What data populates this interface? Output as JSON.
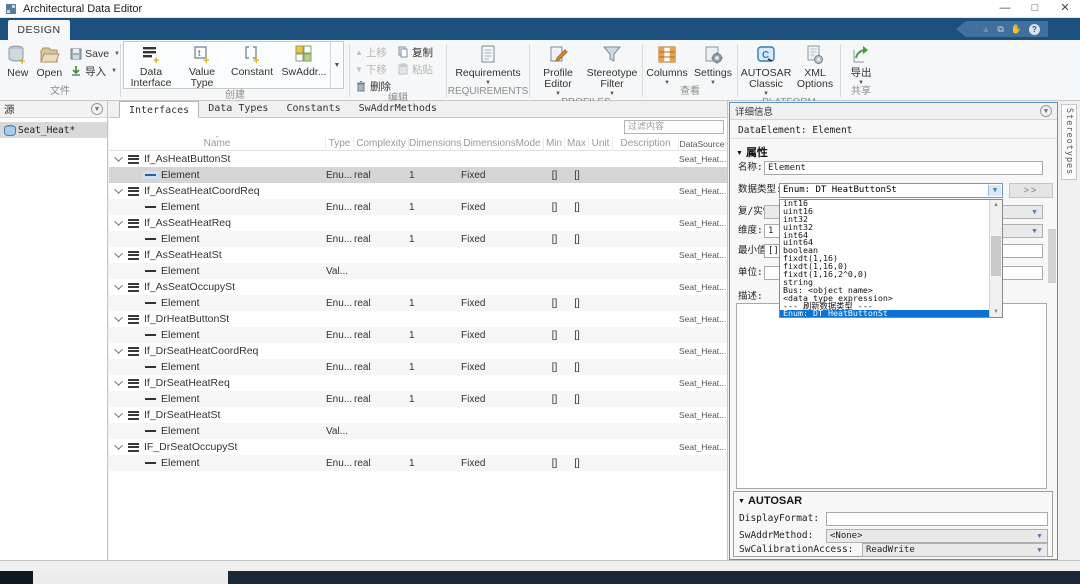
{
  "window": {
    "title": "Architectural Data Editor",
    "minimize": "—",
    "maximize": "□",
    "close": "✕"
  },
  "ribbon": {
    "tab": "DESIGN"
  },
  "toolbar": {
    "file": {
      "label": "文件",
      "new": "New",
      "open": "Open",
      "save": "Save",
      "import": "导入"
    },
    "create": {
      "label": "创建",
      "data_interface": "Data Interface",
      "value_type": "Value Type",
      "constant": "Constant",
      "swaddr": "SwAddr..."
    },
    "edit": {
      "label": "编辑",
      "move_up": "上移",
      "move_down": "下移",
      "delete": "删除",
      "copy": "复制",
      "paste": "粘贴"
    },
    "requirements": {
      "label": "REQUIREMENTS",
      "requirements": "Requirements"
    },
    "profiles": {
      "label": "PROFILES",
      "profile_editor": "Profile Editor",
      "stereotype_filter": "Stereotype Filter"
    },
    "view": {
      "label": "查看",
      "columns": "Columns",
      "settings": "Settings"
    },
    "platform": {
      "label": "PLATFORM",
      "autosar": "AUTOSAR Classic",
      "xml_options": "XML Options"
    },
    "share": {
      "label": "共享",
      "export": "导出"
    }
  },
  "source_panel": {
    "title": "源",
    "item": "Seat_Heat*"
  },
  "main": {
    "tabs": [
      {
        "label": "Interfaces",
        "active": true
      },
      {
        "label": "Data Types",
        "active": false
      },
      {
        "label": "Constants",
        "active": false
      },
      {
        "label": "SwAddrMethods",
        "active": false
      }
    ],
    "filter_placeholder": "过滤内容",
    "table": {
      "columns": [
        "Name",
        "Type",
        "Complexity",
        "Dimensions",
        "DimensionsMode",
        "Min",
        "Max",
        "Unit",
        "Description",
        "DataSource"
      ],
      "rows": [
        {
          "name": "If_AsHeatButtonSt",
          "kind": "interface",
          "dataSource": "Seat_Heat...."
        },
        {
          "name": "Element",
          "kind": "element",
          "selected": true,
          "type": "Enu...",
          "complexity": "real",
          "dimensions": "1",
          "dimensionsMode": "Fixed",
          "min": "[]",
          "max": "[]"
        },
        {
          "name": "If_AsSeatHeatCoordReq",
          "kind": "interface",
          "dataSource": "Seat_Heat...."
        },
        {
          "name": "Element",
          "kind": "element",
          "type": "Enu...",
          "complexity": "real",
          "dimensions": "1",
          "dimensionsMode": "Fixed",
          "min": "[]",
          "max": "[]"
        },
        {
          "name": "If_AsSeatHeatReq",
          "kind": "interface",
          "dataSource": "Seat_Heat...."
        },
        {
          "name": "Element",
          "kind": "element",
          "type": "Enu...",
          "complexity": "real",
          "dimensions": "1",
          "dimensionsMode": "Fixed",
          "min": "[]",
          "max": "[]"
        },
        {
          "name": "If_AsSeatHeatSt",
          "kind": "interface",
          "dataSource": "Seat_Heat...."
        },
        {
          "name": "Element",
          "kind": "element",
          "type": "Val..."
        },
        {
          "name": "If_AsSeatOccupySt",
          "kind": "interface",
          "dataSource": "Seat_Heat...."
        },
        {
          "name": "Element",
          "kind": "element",
          "type": "Enu...",
          "complexity": "real",
          "dimensions": "1",
          "dimensionsMode": "Fixed",
          "min": "[]",
          "max": "[]"
        },
        {
          "name": "If_DrHeatButtonSt",
          "kind": "interface",
          "dataSource": "Seat_Heat...."
        },
        {
          "name": "Element",
          "kind": "element",
          "type": "Enu...",
          "complexity": "real",
          "dimensions": "1",
          "dimensionsMode": "Fixed",
          "min": "[]",
          "max": "[]"
        },
        {
          "name": "If_DrSeatHeatCoordReq",
          "kind": "interface",
          "dataSource": "Seat_Heat...."
        },
        {
          "name": "Element",
          "kind": "element",
          "type": "Enu...",
          "complexity": "real",
          "dimensions": "1",
          "dimensionsMode": "Fixed",
          "min": "[]",
          "max": "[]"
        },
        {
          "name": "If_DrSeatHeatReq",
          "kind": "interface",
          "dataSource": "Seat_Heat...."
        },
        {
          "name": "Element",
          "kind": "element",
          "type": "Enu...",
          "complexity": "real",
          "dimensions": "1",
          "dimensionsMode": "Fixed",
          "min": "[]",
          "max": "[]"
        },
        {
          "name": "If_DrSeatHeatSt",
          "kind": "interface",
          "dataSource": "Seat_Heat...."
        },
        {
          "name": "Element",
          "kind": "element",
          "type": "Val..."
        },
        {
          "name": "IF_DrSeatOccupySt",
          "kind": "interface",
          "dataSource": "Seat_Heat...."
        },
        {
          "name": "Element",
          "kind": "element",
          "type": "Enu...",
          "complexity": "real",
          "dimensions": "1",
          "dimensionsMode": "Fixed",
          "min": "[]",
          "max": "[]"
        }
      ]
    }
  },
  "details": {
    "title": "详细信息",
    "subject": "DataElement: Element",
    "sections": {
      "properties": "属性",
      "autosar": "AUTOSAR"
    },
    "fields": {
      "name": {
        "label": "名称:",
        "value": "Element"
      },
      "data_type": {
        "label": "数据类型:",
        "value": "Enum: DT HeatButtonSt",
        "more": ">>",
        "options": [
          "int16",
          "uint16",
          "int32",
          "uint32",
          "int64",
          "uint64",
          "boolean",
          "fixdt(1,16)",
          "fixdt(1,16,0)",
          "fixdt(1,16,2^0,0)",
          "string",
          "Bus: <object name>",
          "<data type expression>",
          "--- 刷新数据类型 ---",
          "Enum: DT HeatButtonSt"
        ],
        "selected_index": 14
      },
      "complexity": {
        "label": "复/实性:"
      },
      "dimensions": {
        "label": "维度:",
        "value": "1"
      },
      "min": {
        "label": "最小值:",
        "value": "[]"
      },
      "unit": {
        "label": "单位:",
        "value": ""
      },
      "description": {
        "label": "描述:",
        "value": ""
      },
      "display_format": {
        "label": "DisplayFormat:",
        "value": ""
      },
      "sw_addr_method": {
        "label": "SwAddrMethod:",
        "value": "<None>"
      },
      "sw_calibration_access": {
        "label": "SwCalibrationAccess:",
        "value": "ReadWrite"
      }
    }
  },
  "stereotypes_tab": "Stereotypes",
  "colors": {
    "ribbon_blue": "#1b4f7e",
    "selection_blue": "#0a72d7",
    "panel_border_blue": "#5b91c9",
    "row_selected": "#d5d5d5"
  }
}
